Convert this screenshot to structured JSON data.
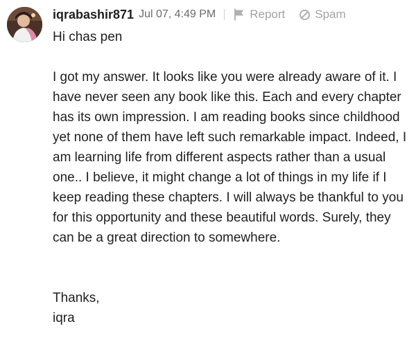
{
  "comment": {
    "username": "iqrabashir871",
    "timestamp": "Jul 07, 4:49 PM",
    "actions": {
      "report_label": "Report",
      "report_icon": "flag-icon",
      "spam_label": "Spam",
      "spam_icon": "block-icon"
    },
    "body": {
      "greeting": "Hi chas pen",
      "paragraph": "I got my answer. It looks like you were already aware of it. I have never seen any book like this. Each and every chapter has its own impression. I am reading books since childhood yet none of them have left such remarkable impact. Indeed, I am learning life from different aspects rather than a usual one.. I believe, it might change a lot of things in my life if I keep reading these chapters. I will always be thankful to you for this opportunity and these beautiful words. Surely, they can be a great direction to somewhere.",
      "signoff": "Thanks,",
      "signature": "iqra"
    }
  }
}
